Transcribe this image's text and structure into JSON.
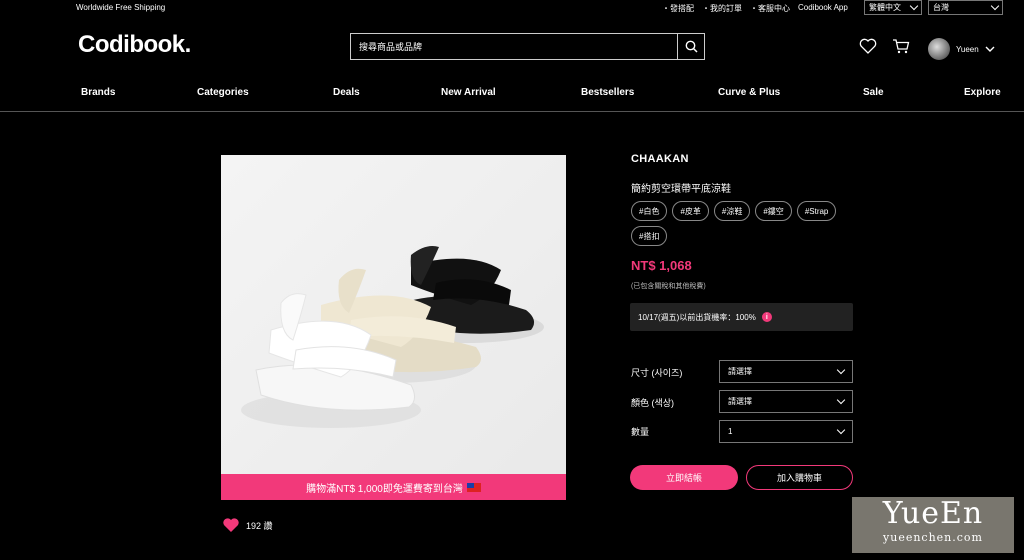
{
  "topbar": {
    "shipping": "Worldwide Free Shipping",
    "links": [
      "・發搭配",
      "・我的訂單",
      "・客服中心",
      "Codibook App"
    ],
    "language": "繁體中文",
    "region": "台灣"
  },
  "header": {
    "logo": "Codibook.",
    "search_placeholder": "搜尋商品或品牌",
    "user_name": "Yueen"
  },
  "nav": {
    "items": [
      "Brands",
      "Categories",
      "Deals",
      "New Arrival",
      "Bestsellers",
      "Curve & Plus",
      "Sale",
      "Explore"
    ]
  },
  "product": {
    "banner": "購物滿NT$ 1,000即免運費寄到台灣",
    "likes": "192 讚",
    "brand": "CHAAKAN",
    "name": "簡約剪空環帶平底涼鞋",
    "tags": [
      "#白色",
      "#皮革",
      "#涼鞋",
      "#鏤空",
      "#Strap",
      "#搭扣"
    ],
    "price": "NT$ 1,068",
    "tax_note": "(已包含關稅和其他稅費)",
    "shipping_note": "10/17(週五)以前出貨機率：100%",
    "size_label": "尺寸 (사이즈)",
    "size_value": "請選擇",
    "color_label": "顏色 (색상)",
    "color_value": "請選擇",
    "qty_label": "數量",
    "qty_value": "1",
    "buy_label": "立即結帳",
    "cart_label": "加入購物車"
  },
  "watermark": {
    "big": "YueEn",
    "small": "yueenchen.com"
  },
  "colors": {
    "accent": "#f2397a",
    "background": "#000000"
  }
}
